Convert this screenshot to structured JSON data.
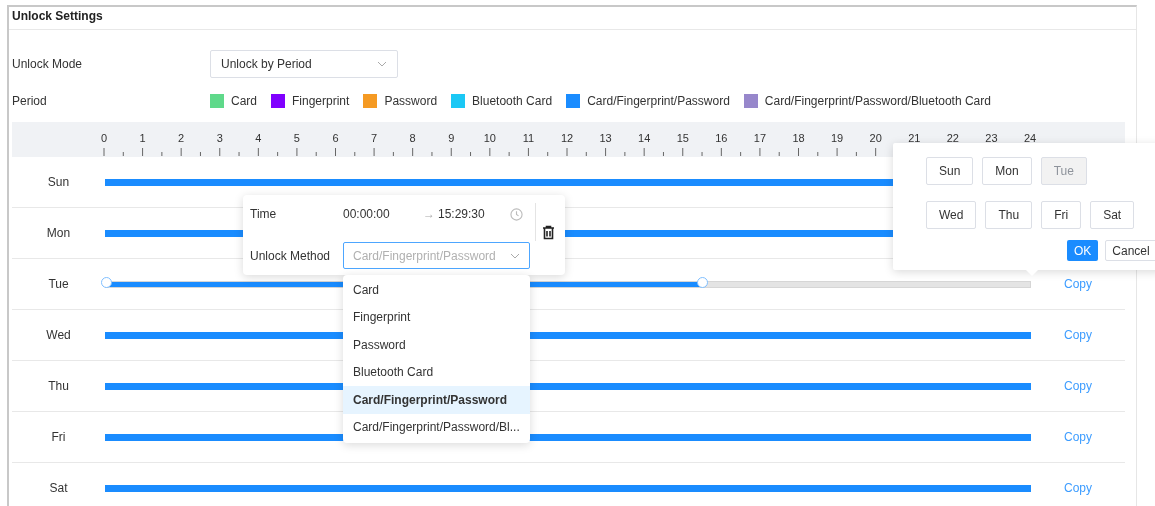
{
  "title": "Unlock Settings",
  "unlock_mode": {
    "label": "Unlock Mode",
    "value": "Unlock by Period"
  },
  "period": {
    "label": "Period",
    "legend": [
      {
        "label": "Card",
        "color": "#5fd98a"
      },
      {
        "label": "Fingerprint",
        "color": "#8000ff"
      },
      {
        "label": "Password",
        "color": "#f59a23"
      },
      {
        "label": "Bluetooth Card",
        "color": "#1bc8f5"
      },
      {
        "label": "Card/Fingerprint/Password",
        "color": "#1a8cff"
      },
      {
        "label": "Card/Fingerprint/Password/Bluetooth Card",
        "color": "#9787cb"
      }
    ]
  },
  "hours": [
    "0",
    "1",
    "2",
    "3",
    "4",
    "5",
    "6",
    "7",
    "8",
    "9",
    "10",
    "11",
    "12",
    "13",
    "14",
    "15",
    "16",
    "17",
    "18",
    "19",
    "20",
    "21",
    "22",
    "23",
    "24"
  ],
  "days": [
    {
      "label": "Sun",
      "level": 1,
      "selected": false
    },
    {
      "label": "Mon",
      "level": 1,
      "selected": false
    },
    {
      "label": "Tue",
      "level": 0.6455,
      "selected": true,
      "copy": "Copy"
    },
    {
      "label": "Wed",
      "level": 1,
      "selected": false,
      "copy": "Copy"
    },
    {
      "label": "Thu",
      "level": 1,
      "selected": false,
      "copy": "Copy"
    },
    {
      "label": "Fri",
      "level": 1,
      "selected": false,
      "copy": "Copy"
    },
    {
      "label": "Sat",
      "level": 1,
      "selected": false,
      "copy": "Copy"
    }
  ],
  "time_editor": {
    "time_label": "Time",
    "start": "00:00:00",
    "arrow": "→",
    "end": "15:29:30",
    "method_label": "Unlock Method",
    "method_value": "Card/Fingerprint/Password",
    "options": [
      {
        "label": "Card",
        "selected": false
      },
      {
        "label": "Fingerprint",
        "selected": false
      },
      {
        "label": "Password",
        "selected": false
      },
      {
        "label": "Bluetooth Card",
        "selected": false
      },
      {
        "label": "Card/Fingerprint/Password",
        "selected": true
      },
      {
        "label": "Card/Fingerprint/Password/Bl...",
        "selected": false
      }
    ]
  },
  "copy_popup": {
    "days": [
      {
        "label": "Sun",
        "disabled": false
      },
      {
        "label": "Mon",
        "disabled": false
      },
      {
        "label": "Tue",
        "disabled": true
      },
      {
        "label": "Wed",
        "disabled": false
      },
      {
        "label": "Thu",
        "disabled": false
      },
      {
        "label": "Fri",
        "disabled": false
      },
      {
        "label": "Sat",
        "disabled": false
      }
    ],
    "ok": "OK",
    "cancel": "Cancel"
  }
}
